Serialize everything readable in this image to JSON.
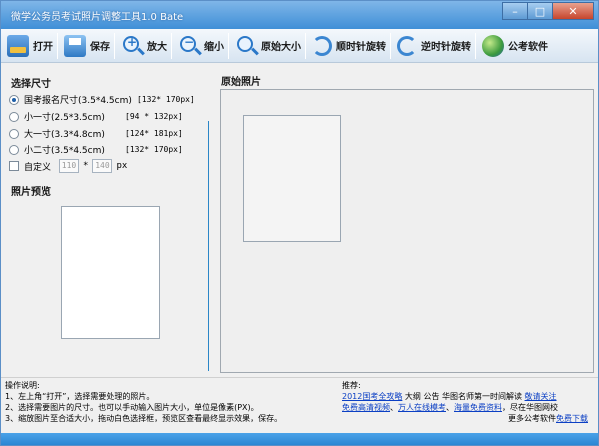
{
  "window": {
    "title": "微学公务员考试照片调整工具1.0 Bate",
    "minimize": "–",
    "maximize": "□",
    "close": "✕"
  },
  "toolbar": {
    "open": "打开",
    "save": "保存",
    "zoom_in": "放大",
    "zoom_out": "缩小",
    "original_size": "原始大小",
    "rotate_cw": "顺时针旋转",
    "rotate_ccw": "逆时针旋转",
    "exam_software": "公考软件"
  },
  "size_panel": {
    "title": "选择尺寸",
    "options": [
      {
        "label": "国考报名尺寸(3.5*4.5cm)",
        "size": "[132* 170px]",
        "selected": true
      },
      {
        "label": "小一寸(2.5*3.5cm)",
        "size": "[94 * 132px]",
        "selected": false
      },
      {
        "label": "大一寸(3.3*4.8cm)",
        "size": "[124* 181px]",
        "selected": false
      },
      {
        "label": "小二寸(3.5*4.5cm)",
        "size": "[132* 170px]",
        "selected": false
      }
    ],
    "custom_label": "自定义",
    "custom_width": "110",
    "custom_times": "*",
    "custom_height": "140",
    "custom_unit": "px"
  },
  "preview": {
    "title": "照片预览"
  },
  "original": {
    "title": "原始照片"
  },
  "instructions": {
    "title": "操作说明:",
    "lines": [
      "1、左上角“打开”，选择需要处理的照片。",
      "2、选择需要图片的尺寸。也可以手动输入图片大小，单位是像素(PX)。",
      "3、缩放图片至合适大小，拖动白色选择框，预览区查看最终显示效果，保存。"
    ]
  },
  "recommend": {
    "title": "推荐:",
    "line1_link1": "2012国考全攻略",
    "line1_text": " 大纲 公告 华图名师第一时间解读 ",
    "line1_link2": "敬请关注",
    "line2_link1": "免费高清视频",
    "line2_sep1": "、",
    "line2_link2": "万人在线模考",
    "line2_sep2": "、",
    "line2_link3": "海量免费资料",
    "line2_text": "，尽在华图网校",
    "line3_text": "更多公考软件",
    "line3_link": "免费下载"
  },
  "colors": {
    "title_bar": "#3f8fd7",
    "link": "#0b3fc4",
    "accent_line": "#2a86c7"
  }
}
